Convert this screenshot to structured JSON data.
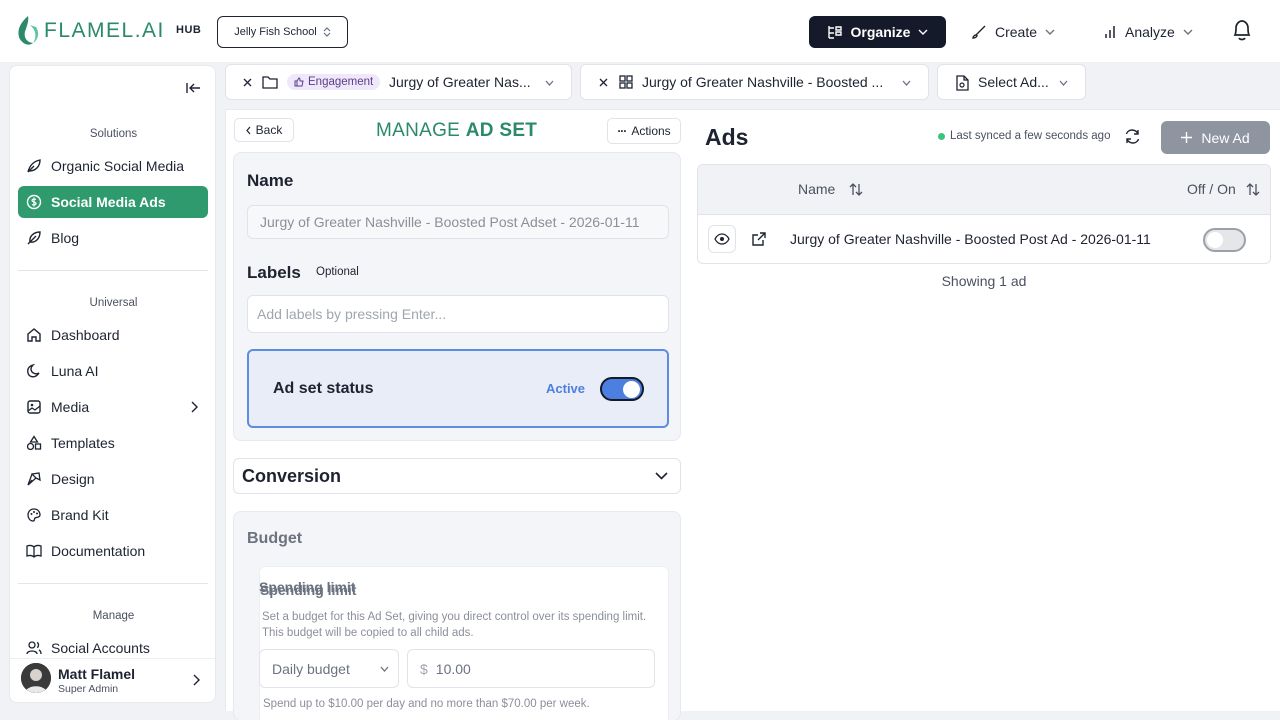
{
  "brand": {
    "logo_text": "FLAMEL.AI",
    "hub": "HUB",
    "accent": "#2a8a6a"
  },
  "header": {
    "school": "Jelly Fish School",
    "organize": "Organize",
    "create": "Create",
    "analyze": "Analyze"
  },
  "sidebar": {
    "solutions_title": "Solutions",
    "organic": "Organic Social Media",
    "social_ads": "Social Media Ads",
    "blog": "Blog",
    "universal_title": "Universal",
    "dashboard": "Dashboard",
    "luna": "Luna AI",
    "media": "Media",
    "templates": "Templates",
    "design": "Design",
    "brand_kit": "Brand Kit",
    "documentation": "Documentation",
    "manage_title": "Manage",
    "social_accounts": "Social Accounts",
    "user_name": "Matt Flamel",
    "user_role": "Super Admin"
  },
  "tabs": {
    "tab1_pill": "Engagement",
    "tab1_label": "Jurgy of Greater Nas...",
    "tab2_label": "Jurgy of Greater Nashville - Boosted ...",
    "tab3_label": "Select Ad..."
  },
  "manage": {
    "back": "Back",
    "title_light": "MANAGE ",
    "title_bold": "AD SET",
    "actions": "Actions",
    "name_label": "Name",
    "name_value": "Jurgy of Greater Nashville - Boosted Post Adset - 2026-01-11",
    "labels_label": "Labels",
    "labels_optional": "Optional",
    "labels_placeholder": "Add labels by pressing Enter...",
    "status_label": "Ad set status",
    "status_value": "Active",
    "conversion": "Conversion",
    "budget": "Budget",
    "spending_limit": "Spending limit",
    "spending_desc": "Set a budget for this Ad Set, giving you direct control over its spending limit. This budget will be copied to all child ads.",
    "budget_type": "Daily budget",
    "currency": "$",
    "budget_amount": "10.00",
    "spend_note": "Spend up to $10.00 per day and no more than $70.00 per week."
  },
  "ads": {
    "title": "Ads",
    "synced": "Last synced a few seconds ago",
    "new_ad": "New Ad",
    "col_name": "Name",
    "col_toggle": "Off / On",
    "rows": [
      {
        "name": "Jurgy of Greater Nashville - Boosted Post Ad - 2026-01-11",
        "on": false
      }
    ],
    "footer": "Showing 1 ad"
  }
}
